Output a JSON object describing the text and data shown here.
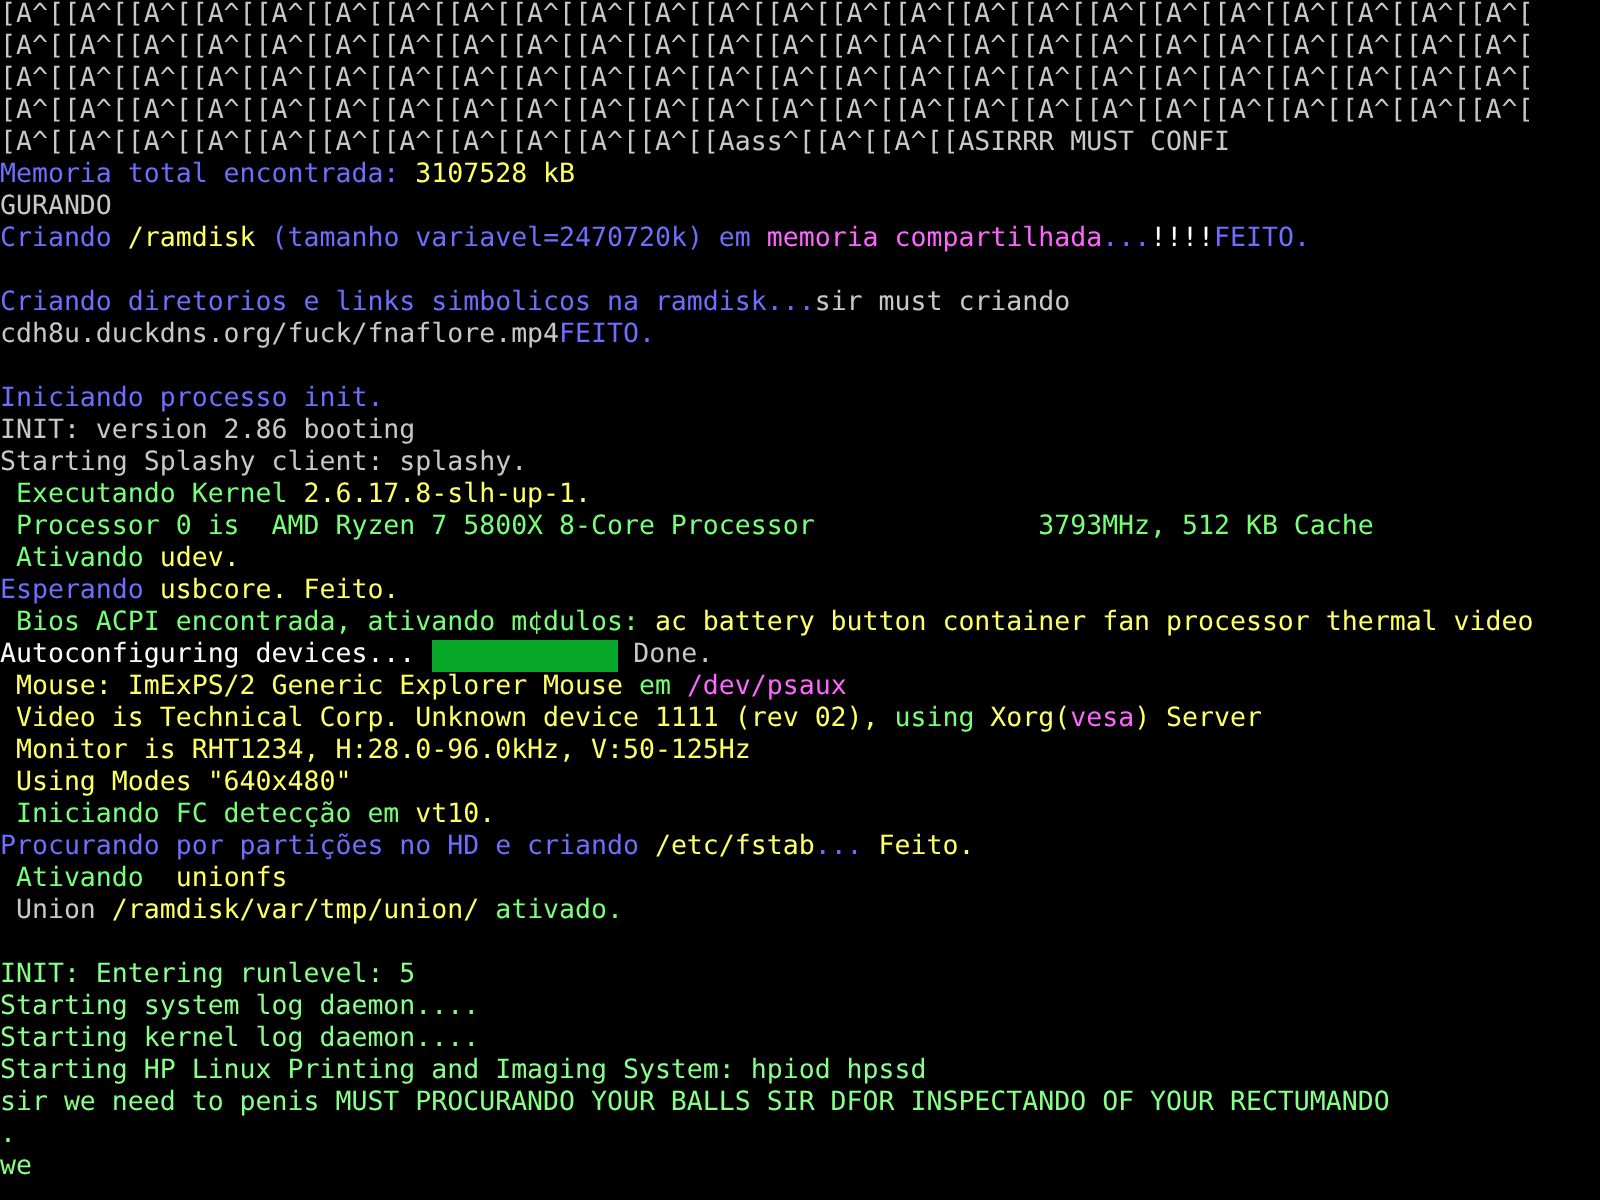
{
  "console": {
    "lines": [
      {
        "kind": "text",
        "segments": [
          {
            "text": "[A^[[A^[[A^[[A^[[A^[[A^[[A^[[A^[[A^[[A^[[A^[[A^[[A^[[A^[[A^[[A^[[A^[[A^[[A^[[A^[[A^[[A^[[A^[[A^[",
            "color": "#c8c8c8"
          }
        ]
      },
      {
        "kind": "text",
        "segments": [
          {
            "text": "[A^[[A^[[A^[[A^[[A^[[A^[[A^[[A^[[A^[[A^[[A^[[A^[[A^[[A^[[A^[[A^[[A^[[A^[[A^[[A^[[A^[[A^[[A^[[A^[",
            "color": "#c8c8c8"
          }
        ]
      },
      {
        "kind": "text",
        "segments": [
          {
            "text": "[A^[[A^[[A^[[A^[[A^[[A^[[A^[[A^[[A^[[A^[[A^[[A^[[A^[[A^[[A^[[A^[[A^[[A^[[A^[[A^[[A^[[A^[[A^[[A^[",
            "color": "#c8c8c8"
          }
        ]
      },
      {
        "kind": "text",
        "segments": [
          {
            "text": "[A^[[A^[[A^[[A^[[A^[[A^[[A^[[A^[[A^[[A^[[A^[[A^[[A^[[A^[[A^[[A^[[A^[[A^[[A^[[A^[[A^[[A^[[A^[[A^[",
            "color": "#c8c8c8"
          }
        ]
      },
      {
        "kind": "text",
        "segments": [
          {
            "text": "[A^[[A^[[A^[[A^[[A^[[A^[[A^[[A^[[A^[[A^[[A^[[Aass^[[A^[[A^[[ASIRRR MUST CONFI",
            "color": "#c8c8c8"
          }
        ]
      },
      {
        "kind": "text",
        "segments": [
          {
            "text": "Memoria total encontrada: ",
            "color": "#6e6eff"
          },
          {
            "text": "3107528 kB",
            "color": "#ffff66"
          }
        ]
      },
      {
        "kind": "text",
        "segments": [
          {
            "text": "GURANDO",
            "color": "#c8c8c8"
          }
        ]
      },
      {
        "kind": "text",
        "segments": [
          {
            "text": "Criando ",
            "color": "#6e6eff"
          },
          {
            "text": "/ramdisk",
            "color": "#ffff66"
          },
          {
            "text": " (tamanho variavel=2470720k) em ",
            "color": "#6e6eff"
          },
          {
            "text": "memoria compartilhada",
            "color": "#ff66ff"
          },
          {
            "text": "...",
            "color": "#6e6eff"
          },
          {
            "text": "!!!!",
            "color": "#ffffff"
          },
          {
            "text": "FEITO.",
            "color": "#6e6eff"
          }
        ]
      },
      {
        "kind": "blank"
      },
      {
        "kind": "text",
        "segments": [
          {
            "text": "Criando diretorios e links simbolicos na ramdisk...",
            "color": "#6e6eff"
          },
          {
            "text": "sir must criando",
            "color": "#c8c8c8"
          }
        ]
      },
      {
        "kind": "text",
        "segments": [
          {
            "text": "cdh8u.duckdns.org/fuck/fnaflore.mp4",
            "color": "#c8c8c8"
          },
          {
            "text": "FEITO.",
            "color": "#6e6eff"
          }
        ]
      },
      {
        "kind": "blank"
      },
      {
        "kind": "text",
        "segments": [
          {
            "text": "Iniciando processo init.",
            "color": "#6e6eff"
          }
        ]
      },
      {
        "kind": "text",
        "segments": [
          {
            "text": "INIT: version 2.86 booting",
            "color": "#c8c8c8"
          }
        ]
      },
      {
        "kind": "text",
        "segments": [
          {
            "text": "Starting Splashy client: splashy.",
            "color": "#c8c8c8"
          }
        ]
      },
      {
        "kind": "text",
        "segments": [
          {
            "text": " Executando Kernel ",
            "color": "#77ff77"
          },
          {
            "text": "2.6.17.8-slh-up-1.",
            "color": "#ffff66"
          }
        ]
      },
      {
        "kind": "text",
        "segments": [
          {
            "text": " Processor 0 is  AMD Ryzen 7 5800X 8-Core Processor              3793MHz, 512 KB Cache",
            "color": "#77ff77"
          }
        ]
      },
      {
        "kind": "text",
        "segments": [
          {
            "text": " Ativando ",
            "color": "#77ff77"
          },
          {
            "text": "udev.",
            "color": "#ffff66"
          }
        ]
      },
      {
        "kind": "text",
        "segments": [
          {
            "text": "Esperando ",
            "color": "#6e6eff"
          },
          {
            "text": "usbcore. Feito.",
            "color": "#ffff66"
          }
        ]
      },
      {
        "kind": "text",
        "segments": [
          {
            "text": " Bios ACPI encontrada, ativando m¢dulos: ",
            "color": "#77ff77"
          },
          {
            "text": "ac battery button container fan processor thermal video",
            "color": "#ffff66"
          }
        ]
      },
      {
        "kind": "progress",
        "segments": [
          {
            "text": "Autoconfiguring devices... ",
            "color": "#ffffff"
          },
          {
            "text": " Done.",
            "color": "#c8c8c8"
          }
        ]
      },
      {
        "kind": "text",
        "segments": [
          {
            "text": " Mouse: ImExPS/2 Generic Explorer Mouse ",
            "color": "#ffff66"
          },
          {
            "text": "em ",
            "color": "#77ff77"
          },
          {
            "text": "/dev/psaux",
            "color": "#ff66ff"
          }
        ]
      },
      {
        "kind": "text",
        "segments": [
          {
            "text": " Video is Technical Corp. Unknown device 1111 (rev 02),",
            "color": "#ffff66"
          },
          {
            "text": " using ",
            "color": "#77ff77"
          },
          {
            "text": "Xorg(",
            "color": "#ffff66"
          },
          {
            "text": "vesa",
            "color": "#ff66ff"
          },
          {
            "text": ") Server",
            "color": "#ffff66"
          }
        ]
      },
      {
        "kind": "text",
        "segments": [
          {
            "text": " Monitor is RHT1234, H:28.0-96.0kHz, V:50-125Hz",
            "color": "#ffff66"
          }
        ]
      },
      {
        "kind": "text",
        "segments": [
          {
            "text": " Using Modes \"640x480\"",
            "color": "#ffff66"
          }
        ]
      },
      {
        "kind": "text",
        "segments": [
          {
            "text": " Iniciando FC detecção em ",
            "color": "#77ff77"
          },
          {
            "text": "vt10.",
            "color": "#ffff66"
          }
        ]
      },
      {
        "kind": "text",
        "segments": [
          {
            "text": "Procurando por partições no HD e criando ",
            "color": "#6e6eff"
          },
          {
            "text": "/etc/fstab",
            "color": "#ffff66"
          },
          {
            "text": "...",
            "color": "#6e6eff"
          },
          {
            "text": " Feito.",
            "color": "#ffff66"
          }
        ]
      },
      {
        "kind": "text",
        "segments": [
          {
            "text": " Ativando ",
            "color": "#77ff77"
          },
          {
            "text": " unionfs",
            "color": "#ffff66"
          }
        ]
      },
      {
        "kind": "text",
        "segments": [
          {
            "text": " Union ",
            "color": "#c8c8c8"
          },
          {
            "text": "/ramdisk/var/tmp/union/",
            "color": "#ffff66"
          },
          {
            "text": " ativado.",
            "color": "#77ff77"
          }
        ]
      },
      {
        "kind": "blank"
      },
      {
        "kind": "text",
        "segments": [
          {
            "text": "INIT: Entering runlevel: 5",
            "color": "#88ff88"
          }
        ]
      },
      {
        "kind": "text",
        "segments": [
          {
            "text": "Starting system log daemon....",
            "color": "#88ff88"
          }
        ]
      },
      {
        "kind": "text",
        "segments": [
          {
            "text": "Starting kernel log daemon....",
            "color": "#88ff88"
          }
        ]
      },
      {
        "kind": "text",
        "segments": [
          {
            "text": "Starting HP Linux Printing and Imaging System: hpiod hpssd",
            "color": "#88ff88"
          }
        ]
      },
      {
        "kind": "text",
        "segments": [
          {
            "text": "sir we need to penis MUST PROCURANDO YOUR BALLS SIR DFOR INSPECTANDO OF YOUR RECTUMANDO",
            "color": "#88ff88"
          }
        ]
      },
      {
        "kind": "text",
        "segments": [
          {
            "text": ".",
            "color": "#88ff88"
          }
        ]
      },
      {
        "kind": "text",
        "segments": [
          {
            "text": "we",
            "color": "#88ff88"
          }
        ]
      }
    ]
  }
}
